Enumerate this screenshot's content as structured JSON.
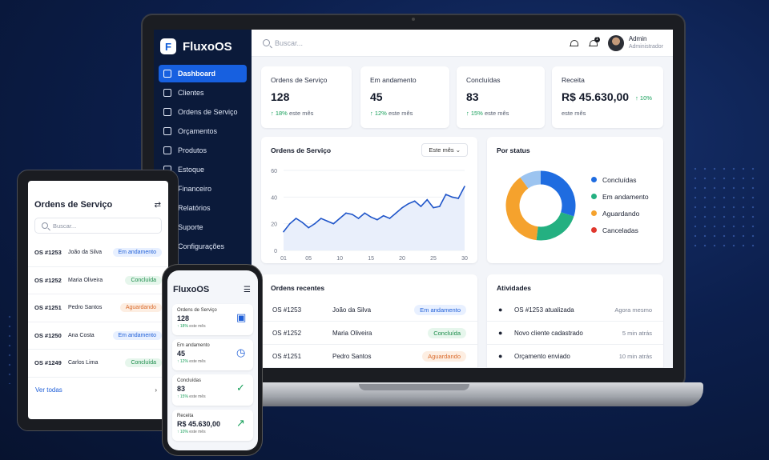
{
  "app": {
    "name": "FluxoOS",
    "logo_letter": "F"
  },
  "sidebar": {
    "items": [
      {
        "label": "Dashboard",
        "active": true
      },
      {
        "label": "Clientes"
      },
      {
        "label": "Ordens de Serviço"
      },
      {
        "label": "Orçamentos"
      },
      {
        "label": "Produtos"
      },
      {
        "label": "Estoque"
      },
      {
        "label": "Financeiro"
      },
      {
        "label": "Relatórios"
      },
      {
        "label": "Suporte"
      },
      {
        "label": "Configurações"
      }
    ]
  },
  "topbar": {
    "search_placeholder": "Buscar...",
    "notifications_count": "1",
    "user_name": "Admin",
    "user_role": "Administrador"
  },
  "kpis": [
    {
      "label": "Ordens de Serviço",
      "value": "128",
      "delta": "↑ 18%",
      "delta_note": "este mês"
    },
    {
      "label": "Em andamento",
      "value": "45",
      "delta": "↑ 12%",
      "delta_note": "este mês"
    },
    {
      "label": "Concluídas",
      "value": "83",
      "delta": "↑ 15%",
      "delta_note": "este mês"
    },
    {
      "label": "Receita",
      "value": "R$ 45.630,00",
      "delta": "↑ 10%",
      "delta_note": "este mês"
    }
  ],
  "line_card": {
    "title": "Ordens de Serviço",
    "period": "Este mês"
  },
  "status_card": {
    "title": "Por status"
  },
  "chart_data": [
    {
      "type": "line",
      "title": "Ordens de Serviço",
      "ylim": [
        0,
        60
      ],
      "yticks": [
        "0",
        "20",
        "40",
        "60"
      ],
      "xticks": [
        "01",
        "05",
        "10",
        "15",
        "20",
        "25",
        "30"
      ],
      "x": [
        1,
        2,
        3,
        4,
        5,
        6,
        7,
        8,
        9,
        10,
        11,
        12,
        13,
        14,
        15,
        16,
        17,
        18,
        19,
        20,
        21,
        22,
        23,
        24,
        25,
        26,
        27,
        28,
        29,
        30
      ],
      "values": [
        14,
        20,
        24,
        21,
        17,
        20,
        24,
        22,
        20,
        24,
        28,
        27,
        24,
        28,
        25,
        23,
        26,
        24,
        28,
        32,
        35,
        37,
        33,
        38,
        32,
        33,
        42,
        40,
        39,
        48
      ],
      "color": "#1f55c9"
    },
    {
      "type": "pie",
      "title": "Por status",
      "labels": [
        "Concluídas",
        "Em andamento",
        "Aguardando",
        "Canceladas"
      ],
      "values": [
        30,
        22,
        38,
        10
      ],
      "colors": [
        "#1f6ce0",
        "#24b081",
        "#f5a22d",
        "#9cc4f0"
      ]
    }
  ],
  "legend": [
    {
      "label": "Concluídas",
      "color": "#1f6ce0"
    },
    {
      "label": "Em andamento",
      "color": "#24b081"
    },
    {
      "label": "Aguardando",
      "color": "#f5a22d"
    },
    {
      "label": "Canceladas",
      "color": "#e0372d"
    }
  ],
  "recent_orders": {
    "title": "Ordens recentes",
    "rows": [
      {
        "id": "OS #1253",
        "client": "João da Silva",
        "status": "Em andamento",
        "tone": "blue"
      },
      {
        "id": "OS #1252",
        "client": "Maria Oliveira",
        "status": "Concluída",
        "tone": "green"
      },
      {
        "id": "OS #1251",
        "client": "Pedro Santos",
        "status": "Aguardando",
        "tone": "orange"
      }
    ]
  },
  "activities": {
    "title": "Atividades",
    "rows": [
      {
        "text": "OS #1253 atualizada",
        "time": "Agora mesmo"
      },
      {
        "text": "Novo cliente cadastrado",
        "time": "5 min atrás"
      },
      {
        "text": "Orçamento enviado",
        "time": "10 min atrás"
      }
    ]
  },
  "tablet": {
    "title": "Ordens de Serviço",
    "search_placeholder": "Buscar...",
    "footer": "Ver todas",
    "rows": [
      {
        "id": "OS #1253",
        "client": "João da Silva",
        "status": "Em andamento",
        "tone": "blue"
      },
      {
        "id": "OS #1252",
        "client": "Maria Oliveira",
        "status": "Concluída",
        "tone": "green"
      },
      {
        "id": "OS #1251",
        "client": "Pedro Santos",
        "status": "Aguardando",
        "tone": "orange"
      },
      {
        "id": "OS #1250",
        "client": "Ana Costa",
        "status": "Em andamento",
        "tone": "blue"
      },
      {
        "id": "OS #1249",
        "client": "Carlos Lima",
        "status": "Concluída",
        "tone": "green"
      }
    ]
  },
  "phone": {
    "title": "FluxoOS",
    "cards": [
      {
        "label": "Ordens de Serviço",
        "value": "128",
        "delta": "↑ 18%",
        "note": "este mês"
      },
      {
        "label": "Em andamento",
        "value": "45",
        "delta": "↑ 12%",
        "note": "este mês"
      },
      {
        "label": "Concluídas",
        "value": "83",
        "delta": "↑ 15%",
        "note": "este mês"
      },
      {
        "label": "Receita",
        "value": "R$ 45.630,00",
        "delta": "↑ 10%",
        "note": "este mês"
      }
    ]
  }
}
